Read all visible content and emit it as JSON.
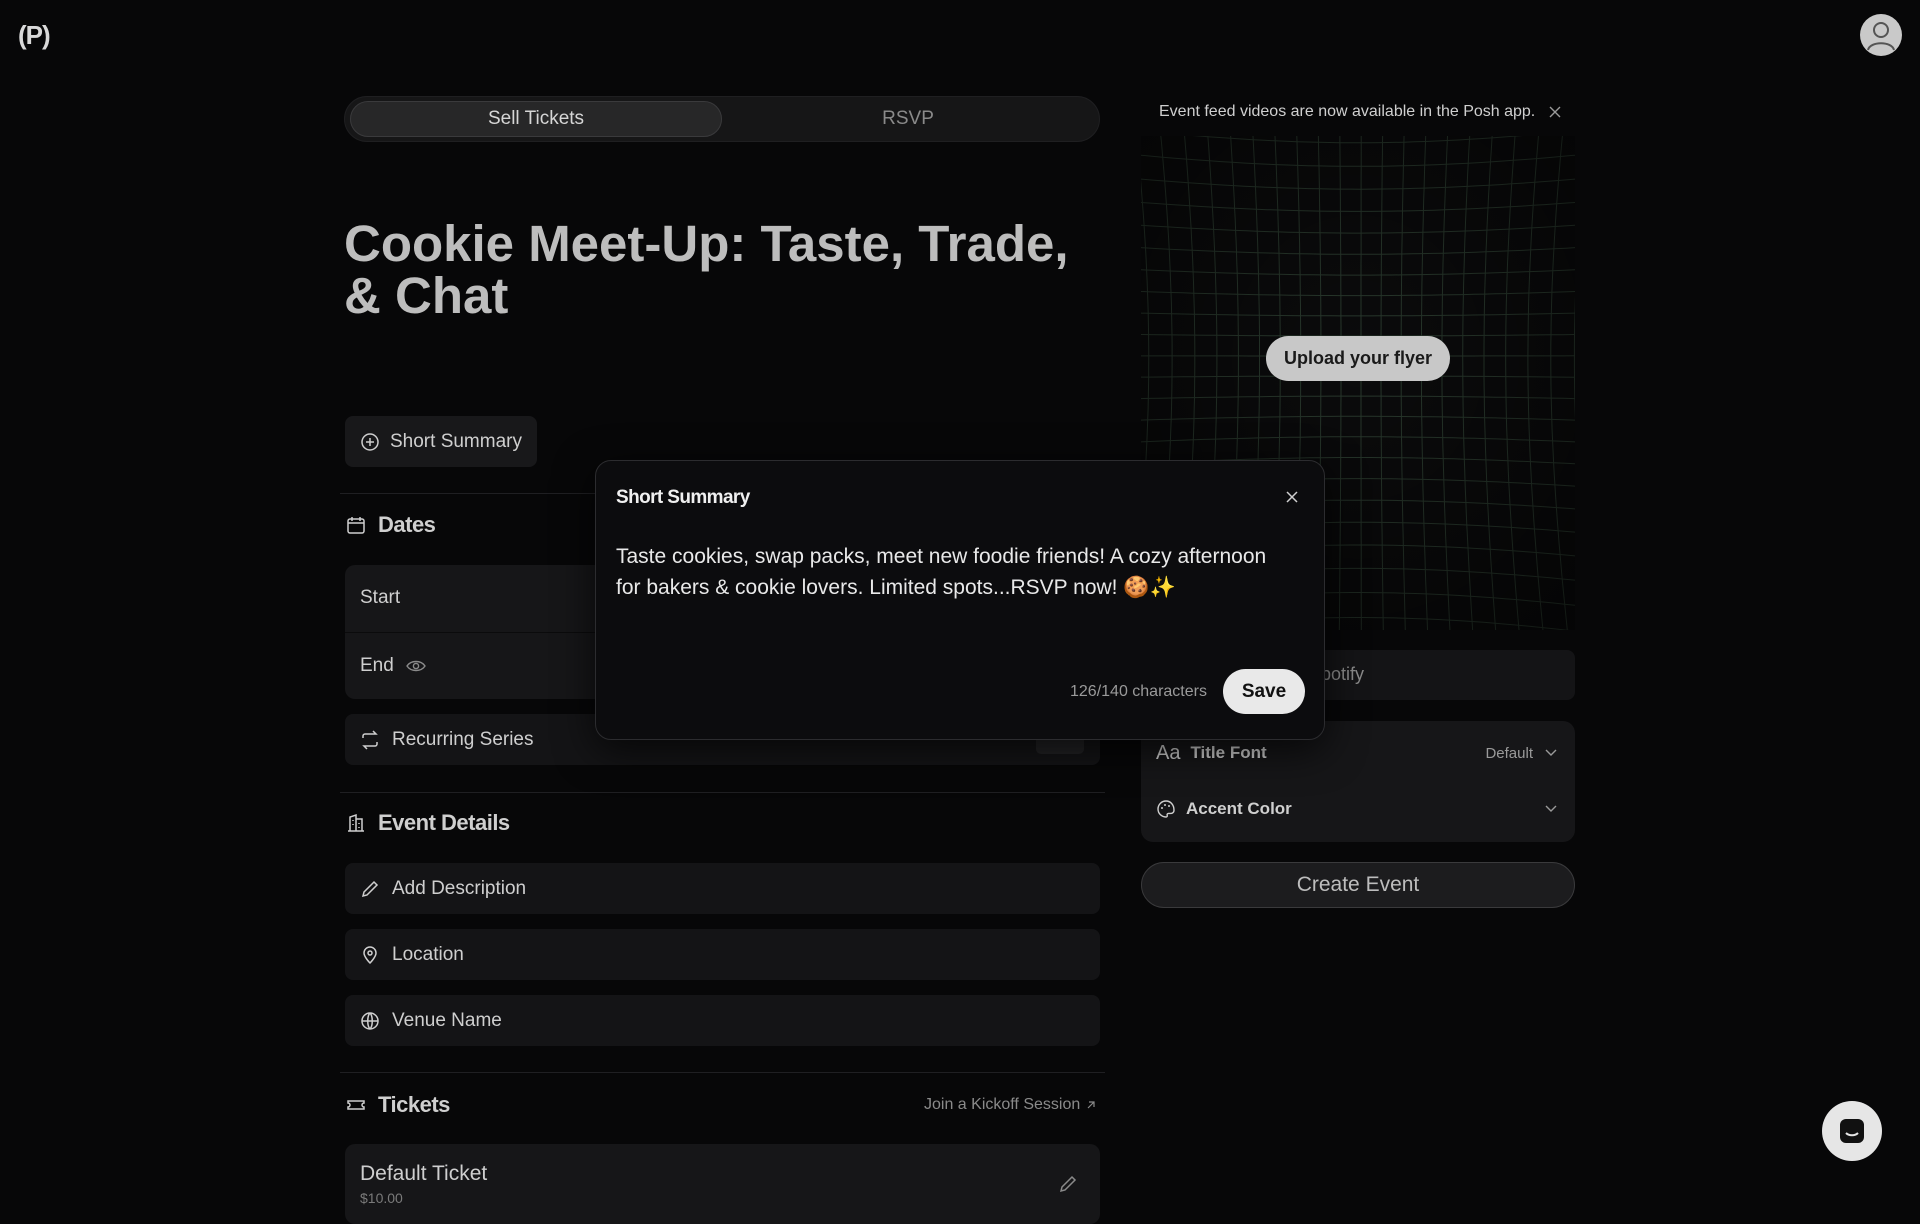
{
  "header": {
    "logo": "(P)",
    "profile_icon": "user-icon"
  },
  "toggle": {
    "sell": "Sell Tickets",
    "rsvp": "RSVP"
  },
  "event": {
    "title": "Cookie Meet-Up: Taste, Trade, & Chat"
  },
  "short_summary_button": "Short Summary",
  "dates": {
    "heading": "Dates",
    "start": "Start",
    "end": "End"
  },
  "recurring": {
    "label": "Recurring Series",
    "value": "No"
  },
  "event_details": {
    "heading": "Event Details",
    "add_description": "Add Description",
    "location": "Location",
    "venue_name": "Venue Name"
  },
  "tickets": {
    "heading": "Tickets",
    "kickoff_link": "Join a Kickoff Session",
    "default_ticket_name": "Default Ticket",
    "default_ticket_price": "$10.00"
  },
  "notice": {
    "text": "Event feed videos are now available in the Posh app."
  },
  "flyer": {
    "upload_button": "Upload your flyer"
  },
  "spotify": {
    "placeholder_partial": "potify"
  },
  "settings": {
    "title_font_icon": "Aa",
    "title_font_label": "Title Font",
    "title_font_value": "Default",
    "accent_color_label": "Accent Color"
  },
  "create_button": "Create Event",
  "modal": {
    "title": "Short Summary",
    "text": "Taste cookies, swap packs, meet new foodie friends! A cozy afternoon for bakers & cookie lovers. Limited spots...RSVP now! 🍪✨",
    "counter": "126/140 characters",
    "save": "Save"
  },
  "colors": {
    "background": "#070708",
    "surface": "#161618",
    "text": "#cfcfcf",
    "button_light": "#e9e9e9"
  }
}
